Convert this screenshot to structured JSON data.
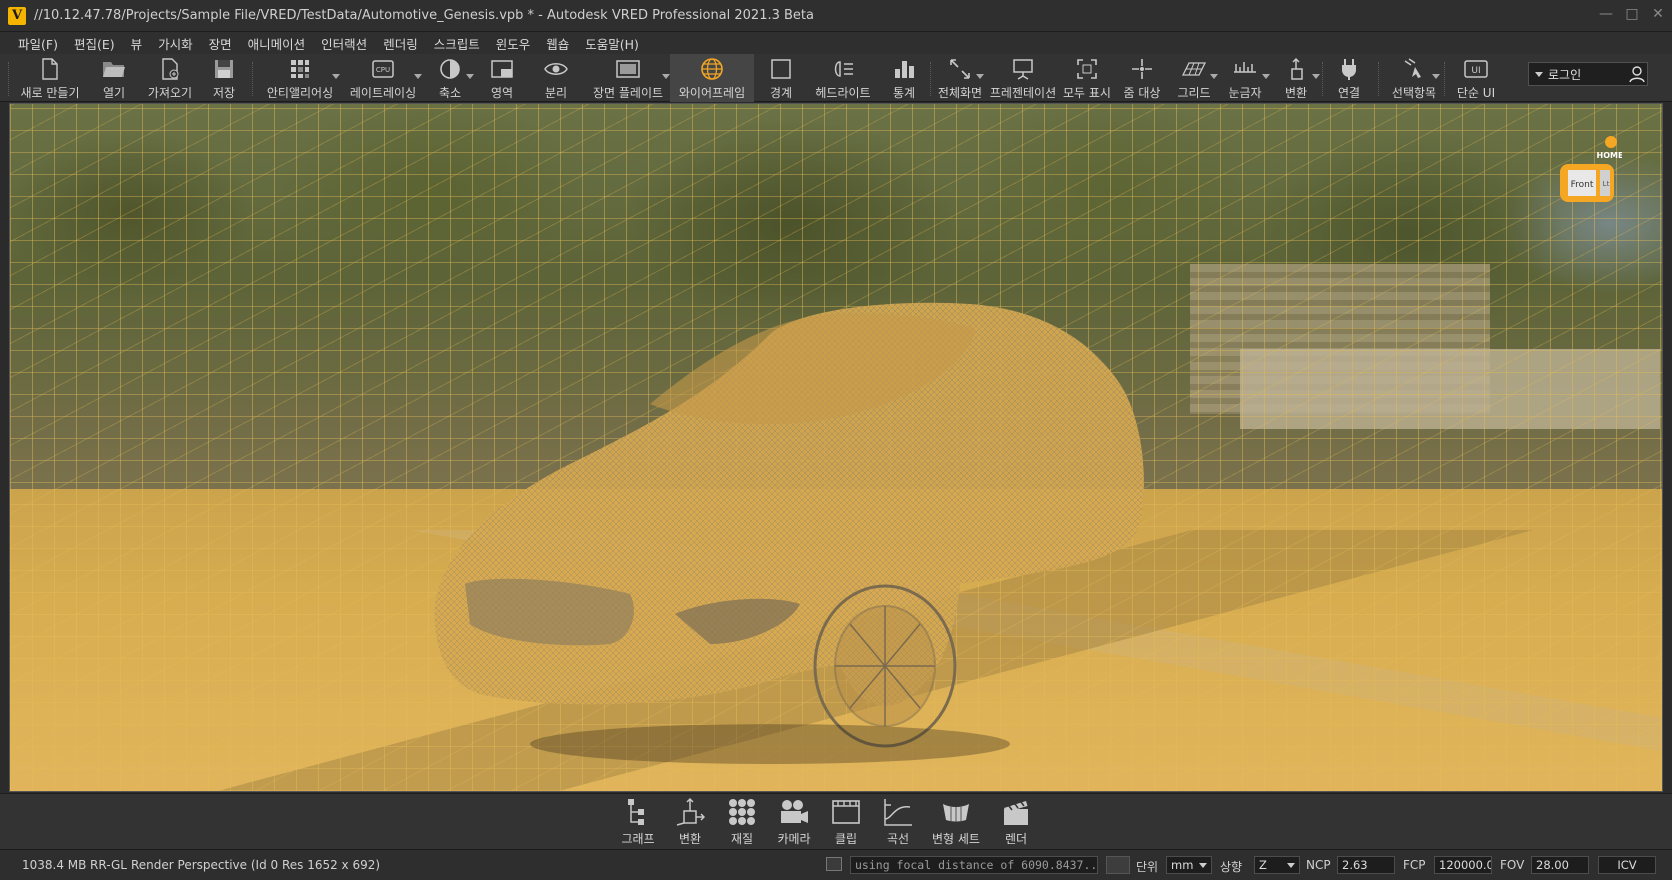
{
  "window": {
    "title": "//10.12.47.78/Projects/Sample File/VRED/TestData/Automotive_Genesis.vpb * - Autodesk VRED Professional 2021.3 Beta",
    "app_icon": "V",
    "controls": [
      "minimize-icon",
      "maximize-icon",
      "close-icon"
    ]
  },
  "menu": [
    "파일(F)",
    "편집(E)",
    "뷰",
    "가시화",
    "장면",
    "애니메이션",
    "인터랙션",
    "렌더링",
    "스크립트",
    "윈도우",
    "웹숍",
    "도움말(H)"
  ],
  "toolbar": {
    "items": [
      {
        "label": "새로 만들기",
        "icon": "new-file-icon"
      },
      {
        "label": "열기",
        "icon": "open-folder-icon"
      },
      {
        "label": "가져오기",
        "icon": "import-icon"
      },
      {
        "label": "저장",
        "icon": "save-icon"
      },
      {
        "label": "안티앨리어싱",
        "icon": "antialiasing-icon"
      },
      {
        "label": "레이트레이싱",
        "icon": "cpu-raytracing-icon"
      },
      {
        "label": "축소",
        "icon": "half-circle-icon"
      },
      {
        "label": "영역",
        "icon": "region-icon"
      },
      {
        "label": "분리",
        "icon": "eye-icon"
      },
      {
        "label": "장면 플레이트",
        "icon": "scene-plate-icon"
      },
      {
        "label": "와이어프레임",
        "icon": "wireframe-sphere-icon",
        "active": true
      },
      {
        "label": "경계",
        "icon": "bounding-box-icon"
      },
      {
        "label": "헤드라이트",
        "icon": "headlight-icon"
      },
      {
        "label": "통계",
        "icon": "statistics-icon"
      },
      {
        "label": "전체화면",
        "icon": "fullscreen-icon"
      },
      {
        "label": "프레젠테이션",
        "icon": "presentation-icon"
      },
      {
        "label": "모두 표시",
        "icon": "show-all-icon"
      },
      {
        "label": "줌 대상",
        "icon": "zoom-target-icon"
      },
      {
        "label": "그리드",
        "icon": "grid-icon"
      },
      {
        "label": "눈금자",
        "icon": "ruler-icon"
      },
      {
        "label": "변환",
        "icon": "transform-icon"
      },
      {
        "label": "연결",
        "icon": "plug-icon"
      },
      {
        "label": "선택항목",
        "icon": "selection-icon"
      },
      {
        "label": "단순 UI",
        "icon": "simple-ui-icon"
      }
    ],
    "login": {
      "label": "로그인",
      "icon": "user-icon"
    }
  },
  "viewport": {
    "navcube": {
      "home_label": "HOME",
      "face_label": "Front",
      "side_label": "Lt"
    }
  },
  "modules": [
    {
      "label": "그래프",
      "icon": "scenegraph-icon"
    },
    {
      "label": "변환",
      "icon": "transform-module-icon"
    },
    {
      "label": "재질",
      "icon": "materials-icon"
    },
    {
      "label": "카메라",
      "icon": "camera-icon"
    },
    {
      "label": "클립",
      "icon": "clip-icon"
    },
    {
      "label": "곡선",
      "icon": "curves-icon"
    },
    {
      "label": "변형 세트",
      "icon": "variant-sets-icon"
    },
    {
      "label": "렌더",
      "icon": "render-icon"
    }
  ],
  "status": {
    "memory": "1038.4 MB",
    "renderer": "RR-GL",
    "render_info": "Render Perspective (Id 0 Res 1652 x 692)",
    "message": "using focal distance of 6090.8437...",
    "unit_label": "단위",
    "unit_value": "mm",
    "up_label": "상향",
    "up_value": "Z",
    "ncp_label": "NCP",
    "ncp_value": "2.63",
    "fcp_label": "FCP",
    "fcp_value": "120000.00",
    "fov_label": "FOV",
    "fov_value": "28.00",
    "icv_label": "ICV"
  },
  "colors": {
    "accent": "#f5a623",
    "wireframe": "#e6b84f",
    "bg": "#2b2b2b"
  }
}
